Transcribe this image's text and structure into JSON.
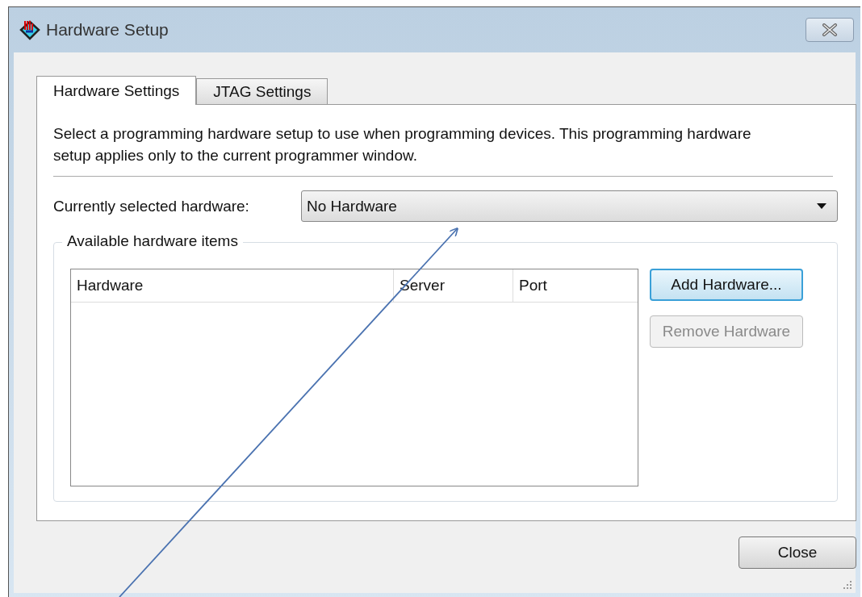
{
  "window": {
    "title": "Hardware Setup"
  },
  "tabs": [
    {
      "label": "Hardware Settings",
      "selected": true
    },
    {
      "label": "JTAG Settings",
      "selected": false
    }
  ],
  "description": "Select a programming hardware setup to use when programming devices. This programming hardware setup applies only to the current programmer window.",
  "hardware_select": {
    "label": "Currently selected hardware:",
    "value": "No Hardware"
  },
  "available_items": {
    "title": "Available hardware items",
    "columns": [
      "Hardware",
      "Server",
      "Port"
    ],
    "buttons": [
      {
        "label": "Add Hardware...",
        "disabled": false
      },
      {
        "label": "Remove Hardware",
        "disabled": true
      }
    ]
  },
  "footer_buttons": [
    {
      "label": "Close",
      "disabled": false
    }
  ]
}
